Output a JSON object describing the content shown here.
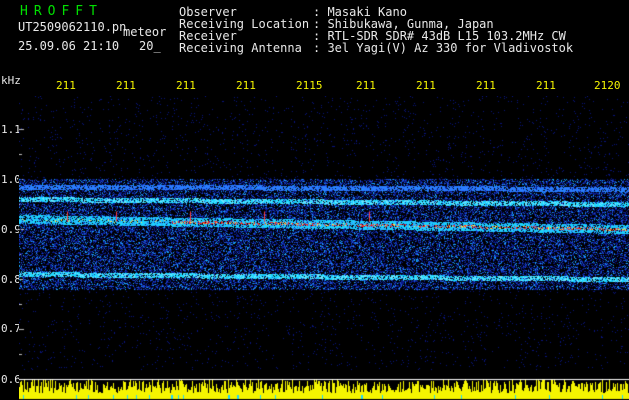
{
  "header": {
    "logo": "HROFFT",
    "filename": "UT2509062110.pn",
    "tag": "meteor",
    "datetime": "25.09.06 21:10",
    "minute_label": "20_",
    "observer_label": "Observer",
    "observer_value": ": Masaki Kano",
    "location_label": "Receiving Location",
    "location_value": ": Shibukawa, Gunma, Japan",
    "receiver_label": "Receiver",
    "receiver_value": ": RTL-SDR SDR# 43dB L15 103.2MHz CW",
    "antenna_label": "Receiving Antenna",
    "antenna_value": ": 3el Yagi(V) Az 330 for Vladivostok"
  },
  "axis": {
    "unit": "kHz",
    "y_ticks": [
      "1.1",
      "1.0",
      "0.9",
      "0.8",
      "0.7",
      "0.6"
    ],
    "x_ticks": [
      "211",
      "211",
      "211",
      "211",
      "2115",
      "211",
      "211",
      "211",
      "211",
      "2120"
    ]
  },
  "colors": {
    "background": "#000000",
    "x_label": "#f5f500",
    "text": "#e8e8e8",
    "logo": "#00e000",
    "signal_low": "#0a1a8c",
    "signal_mid": "#19d7ff",
    "signal_high": "#ff2020",
    "power_bar": "#f5f500"
  },
  "chart_data": {
    "type": "heatmap",
    "ylabel": "kHz",
    "x_tick_labels": [
      "211",
      "211",
      "211",
      "211",
      "2115",
      "211",
      "211",
      "211",
      "211",
      "2120"
    ],
    "y_tick_labels": [
      "1.1",
      "1.0",
      "0.9",
      "0.8",
      "0.7",
      "0.6"
    ],
    "ylim": [
      0.6,
      1.1
    ],
    "traces": [
      {
        "freq_start": 0.92,
        "freq_end": 0.9,
        "intensity": "high"
      },
      {
        "freq_start": 0.96,
        "freq_end": 0.95,
        "intensity": "mid"
      },
      {
        "freq_start": 0.81,
        "freq_end": 0.8,
        "intensity": "mid"
      },
      {
        "freq_start": 0.985,
        "freq_end": 0.98,
        "intensity": "low"
      }
    ],
    "noise_band": [
      0.78,
      1.0
    ],
    "power_bar_level": 0.03
  }
}
